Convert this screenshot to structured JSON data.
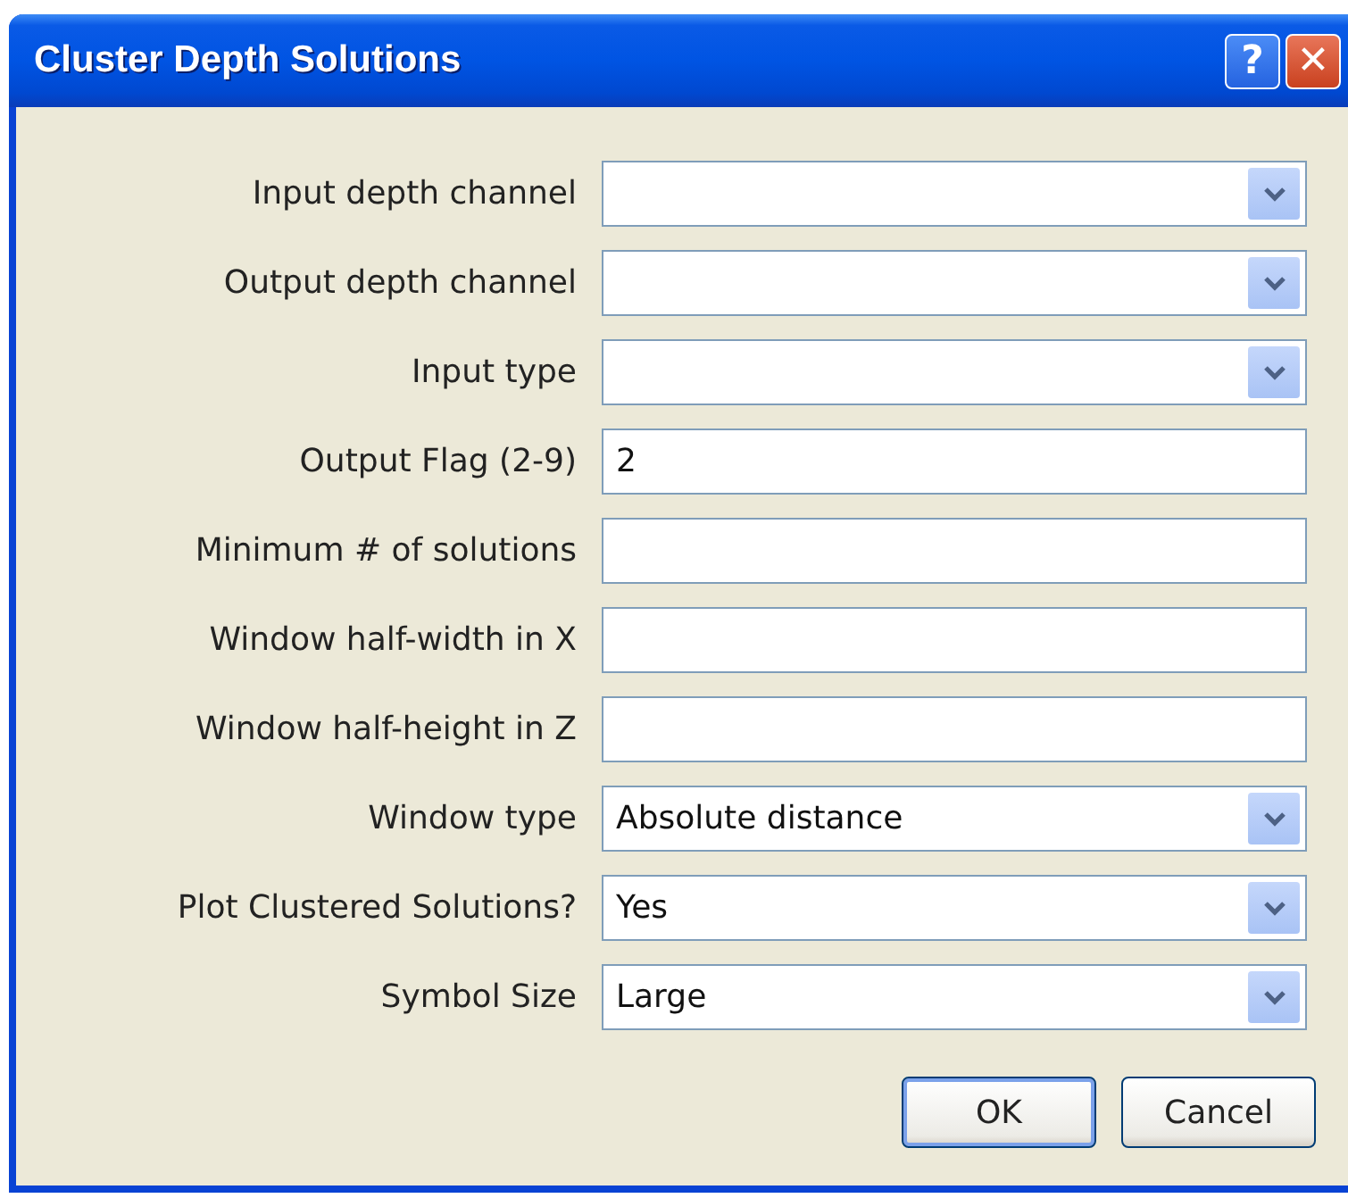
{
  "window": {
    "title": "Cluster Depth Solutions",
    "help_button": "?",
    "close_button": "✕"
  },
  "fields": [
    {
      "label": "Input depth channel",
      "kind": "dropdown"
    },
    {
      "label": "Output depth channel",
      "kind": "dropdown"
    },
    {
      "label": "Input type",
      "kind": "dropdown"
    },
    {
      "label": "Output Flag (2-9)",
      "kind": "text",
      "value": "2"
    },
    {
      "label": "Minimum # of solutions",
      "kind": "text"
    },
    {
      "label": "Window half-width in X",
      "kind": "text"
    },
    {
      "label": "Window half-height in Z",
      "kind": "text"
    },
    {
      "label": "Window type",
      "kind": "dropdown",
      "value": "Absolute distance"
    },
    {
      "label": "Plot Clustered Solutions?",
      "kind": "dropdown",
      "value": "Yes"
    },
    {
      "label": "Symbol Size",
      "kind": "dropdown",
      "value": "Large"
    }
  ],
  "buttons": [
    {
      "label": "OK",
      "default": true
    },
    {
      "label": "Cancel",
      "default": false
    }
  ]
}
